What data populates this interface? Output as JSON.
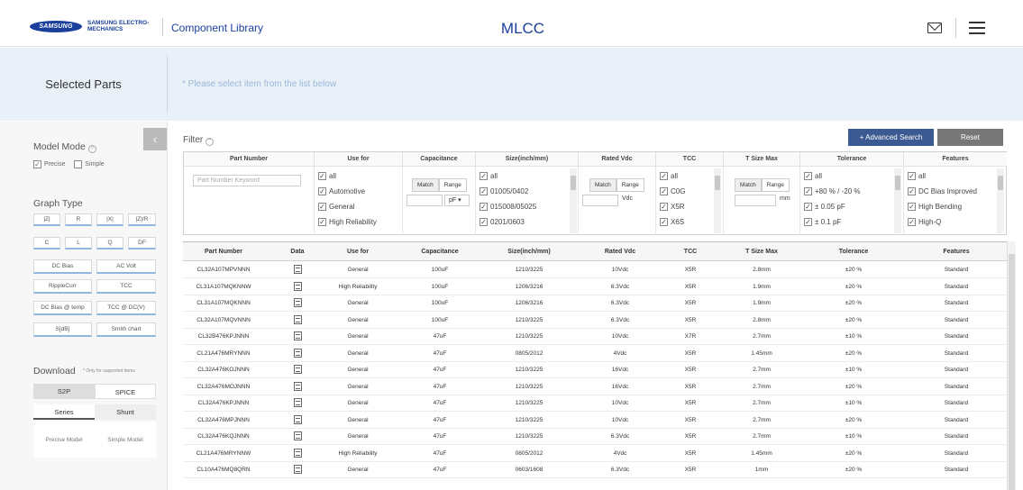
{
  "header": {
    "brand_logo": "SAMSUNG",
    "brand_name": "SAMSUNG ELECTRO-MECHANICS",
    "library_label": "Component Library",
    "page_title": "MLCC",
    "icons": [
      "mail-icon",
      "menu-icon"
    ]
  },
  "selected": {
    "title": "Selected Parts",
    "hint": "* Please select item from the list below"
  },
  "sidebar": {
    "model_mode_label": "Model Mode",
    "model_mode_options": [
      {
        "label": "Precise",
        "checked": true
      },
      {
        "label": "Simple",
        "checked": false
      }
    ],
    "graph_type_label": "Graph Type",
    "graph_row1": [
      "|Z|",
      "R",
      "|X|",
      "|Z|/R"
    ],
    "graph_row2": [
      "C",
      "L",
      "Q",
      "DF"
    ],
    "graph_buttons": [
      "DC Bias",
      "AC Volt",
      "RippleCurr",
      "TCC",
      "DC Bias @ temp",
      "TCC @ DC(V)",
      "S[dB]",
      "Smith chart"
    ],
    "download_label": "Download",
    "download_note": "* Only for supported items",
    "download_tabs": [
      "S2P",
      "SPICE"
    ],
    "topology_tabs": [
      "Series",
      "Shunt"
    ],
    "model_options": [
      "Precise Model",
      "Simple Model"
    ]
  },
  "filter": {
    "label": "Filter",
    "advanced_label": "+ Advanced Search",
    "reset_label": "Reset",
    "columns": [
      "Part Number",
      "Use for",
      "Capacitance",
      "Size(inch/mm)",
      "Rated Vdc",
      "TCC",
      "T Size Max",
      "Tolerance",
      "Features"
    ],
    "part_placeholder": "Part Number Keyword",
    "use_for": [
      "all",
      "Automotive",
      "General",
      "High Reliability"
    ],
    "match_label": "Match",
    "range_label": "Range",
    "cap_unit": "pF",
    "size": [
      "all",
      "01005/0402",
      "015008/05025",
      "0201/0603"
    ],
    "vdc_unit": "Vdc",
    "tcc": [
      "all",
      "C0G",
      "X5R",
      "X6S"
    ],
    "tsize_unit": "mm",
    "tolerance": [
      "all",
      "+80 % / -20 %",
      "± 0.05 pF",
      "± 0.1 pF"
    ],
    "features": [
      "all",
      "DC Bias Improved",
      "High Bending",
      "High-Q"
    ]
  },
  "table": {
    "headers": [
      "Part Number",
      "Data",
      "Use for",
      "Capacitance",
      "Size(inch/mm)",
      "Rated Vdc",
      "TCC",
      "T Size Max",
      "Tolerance",
      "Features"
    ],
    "rows": [
      [
        "CL32A107MPVNNN",
        "General",
        "100uF",
        "1210/3225",
        "10Vdc",
        "X5R",
        "2.8mm",
        "±20 %",
        "Standard"
      ],
      [
        "CL31A107MQKNNW",
        "High Reliability",
        "100uF",
        "1206/3216",
        "6.3Vdc",
        "X5R",
        "1.9mm",
        "±20 %",
        "Standard"
      ],
      [
        "CL31A107MQKNNN",
        "General",
        "100uF",
        "1206/3216",
        "6.3Vdc",
        "X5R",
        "1.9mm",
        "±20 %",
        "Standard"
      ],
      [
        "CL32A107MQVNNN",
        "General",
        "100uF",
        "1210/3225",
        "6.3Vdc",
        "X5R",
        "2.8mm",
        "±20 %",
        "Standard"
      ],
      [
        "CL32B476KPJNNN",
        "General",
        "47uF",
        "1210/3225",
        "10Vdc",
        "X7R",
        "2.7mm",
        "±10 %",
        "Standard"
      ],
      [
        "CL21A476MRYNNN",
        "General",
        "47uF",
        "0805/2012",
        "4Vdc",
        "X5R",
        "1.45mm",
        "±20 %",
        "Standard"
      ],
      [
        "CL32A476KOJNNN",
        "General",
        "47uF",
        "1210/3225",
        "16Vdc",
        "X5R",
        "2.7mm",
        "±10 %",
        "Standard"
      ],
      [
        "CL32A476MOJNNN",
        "General",
        "47uF",
        "1210/3225",
        "16Vdc",
        "X5R",
        "2.7mm",
        "±20 %",
        "Standard"
      ],
      [
        "CL32A476KPJNNN",
        "General",
        "47uF",
        "1210/3225",
        "10Vdc",
        "X5R",
        "2.7mm",
        "±10 %",
        "Standard"
      ],
      [
        "CL32A476MPJNNN",
        "General",
        "47uF",
        "1210/3225",
        "10Vdc",
        "X5R",
        "2.7mm",
        "±20 %",
        "Standard"
      ],
      [
        "CL32A476KQJNNN",
        "General",
        "47uF",
        "1210/3225",
        "6.3Vdc",
        "X5R",
        "2.7mm",
        "±10 %",
        "Standard"
      ],
      [
        "CL21A476MRYNNW",
        "High Reliability",
        "47uF",
        "0805/2012",
        "4Vdc",
        "X5R",
        "1.45mm",
        "±20 %",
        "Standard"
      ],
      [
        "CL10A476MQ8QRN",
        "General",
        "47uF",
        "0603/1608",
        "6.3Vdc",
        "X5R",
        "1mm",
        "±20 %",
        "Standard"
      ]
    ]
  }
}
